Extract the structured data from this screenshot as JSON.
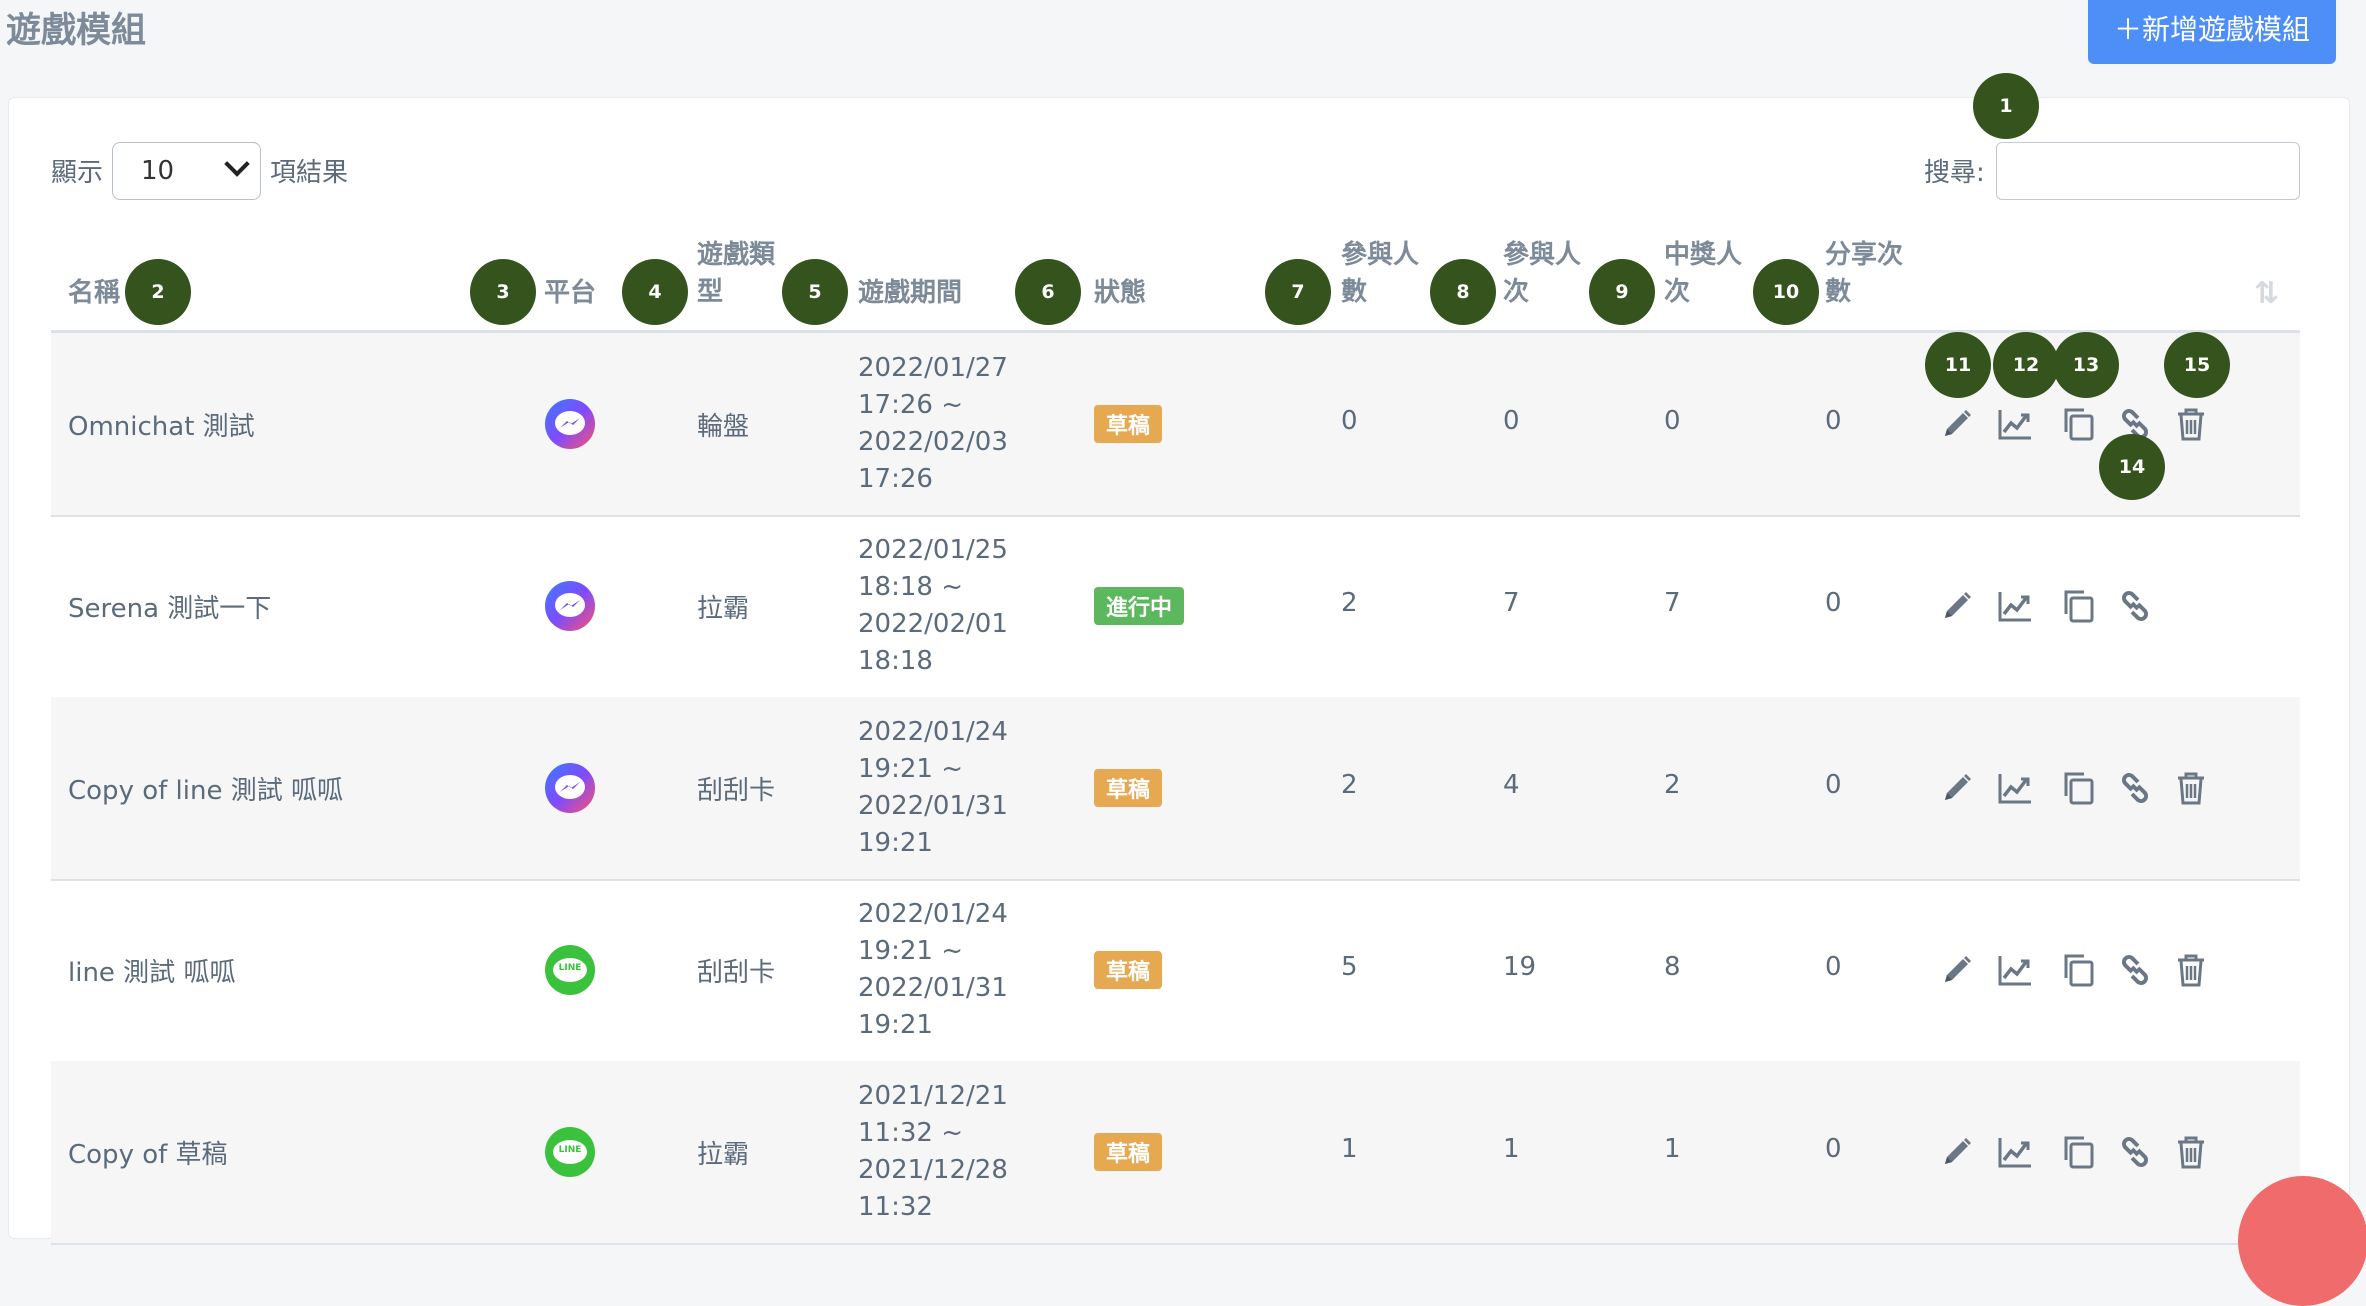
{
  "page": {
    "title": "遊戲模組",
    "add_button": "＋新增遊戲模組"
  },
  "table_controls": {
    "show_label": "顯示",
    "page_length": "10",
    "results_label": "項結果",
    "search_label": "搜尋:",
    "search_value": ""
  },
  "columns": {
    "name": "名稱",
    "platform": "平台",
    "game_type_1": "遊戲類",
    "game_type_2": "型",
    "period": "遊戲期間",
    "status": "狀態",
    "participants_1": "參與人",
    "participants_2": "數",
    "participations_1": "參與人",
    "participations_2": "次",
    "winners_1": "中獎人",
    "winners_2": "次",
    "shares_1": "分享次",
    "shares_2": "數",
    "sort_icon": "⇅"
  },
  "rows": [
    {
      "name": "Omnichat 測試",
      "platform": "messenger",
      "type": "輪盤",
      "period": [
        "2022/01/27",
        "17:26 ~",
        "2022/02/03",
        "17:26"
      ],
      "status": "草稿",
      "status_color": "#e6a851",
      "participants": "0",
      "participations": "0",
      "winners": "0",
      "shares": "0",
      "has_delete": true
    },
    {
      "name": "Serena 測試一下",
      "platform": "messenger",
      "type": "拉霸",
      "period": [
        "2022/01/25",
        "18:18 ~",
        "2022/02/01",
        "18:18"
      ],
      "status": "進行中",
      "status_color": "#5cb85c",
      "participants": "2",
      "participations": "7",
      "winners": "7",
      "shares": "0",
      "has_delete": false
    },
    {
      "name": "Copy of line 測試 呱呱",
      "platform": "messenger",
      "type": "刮刮卡",
      "period": [
        "2022/01/24",
        "19:21 ~",
        "2022/01/31",
        "19:21"
      ],
      "status": "草稿",
      "status_color": "#e6a851",
      "participants": "2",
      "participations": "4",
      "winners": "2",
      "shares": "0",
      "has_delete": true
    },
    {
      "name": "line 測試 呱呱",
      "platform": "line",
      "type": "刮刮卡",
      "period": [
        "2022/01/24",
        "19:21 ~",
        "2022/01/31",
        "19:21"
      ],
      "status": "草稿",
      "status_color": "#e6a851",
      "participants": "5",
      "participations": "19",
      "winners": "8",
      "shares": "0",
      "has_delete": true
    },
    {
      "name": "Copy of 草稿",
      "platform": "line",
      "type": "拉霸",
      "period": [
        "2021/12/21",
        "11:32 ~",
        "2021/12/28",
        "11:32"
      ],
      "status": "草稿",
      "status_color": "#e6a851",
      "participants": "1",
      "participations": "1",
      "winners": "1",
      "shares": "0",
      "has_delete": true
    }
  ],
  "platform_icon_text": {
    "line": "LINE"
  },
  "icons": {
    "edit": "pencil-icon",
    "stats": "line-chart-icon",
    "copy": "copy-icon",
    "link": "link-icon",
    "delete": "trash-icon",
    "messenger": "messenger-icon",
    "line": "line-app-icon"
  },
  "annotations": [
    "1",
    "2",
    "3",
    "4",
    "5",
    "6",
    "7",
    "8",
    "9",
    "10",
    "11",
    "12",
    "13",
    "14",
    "15"
  ],
  "colors": {
    "primary": "#4e8ef7",
    "draft": "#e6a851",
    "active": "#5cb85c",
    "marker": "#35531d"
  }
}
